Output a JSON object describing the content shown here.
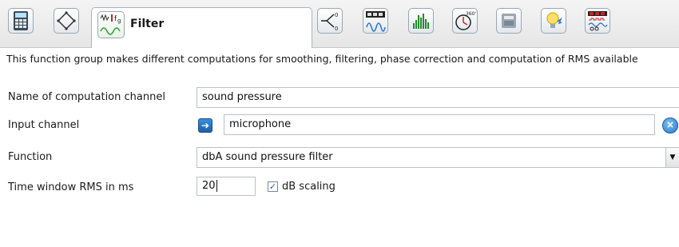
{
  "toolbar": {
    "tabs": [
      {
        "icon": "calculator-icon"
      },
      {
        "icon": "bridge-circuit-icon"
      },
      {
        "icon": "filter-waveform-icon",
        "label": "Filter",
        "active": true
      },
      {
        "icon": "switch-diagram-icon"
      },
      {
        "icon": "counter-waveform-icon"
      },
      {
        "icon": "spectrum-bars-icon"
      },
      {
        "icon": "angle-360-icon"
      },
      {
        "icon": "device-icon"
      },
      {
        "icon": "lightbulb-icon"
      },
      {
        "icon": "signal-display-icon"
      }
    ]
  },
  "description": "This function group makes different computations for smoothing, filtering, phase correction and computation of RMS available",
  "form": {
    "computation_channel_label": "Name of computation channel",
    "computation_channel_value": "sound pressure",
    "input_channel_label": "Input channel",
    "input_channel_value": "microphone",
    "function_label": "Function",
    "function_value": "dbA sound pressure filter",
    "rms_label": "Time window RMS in ms",
    "rms_value": "20",
    "db_scaling_label": "dB scaling",
    "db_scaling_checked": true
  },
  "colors": {
    "accent": "#1f5fa8",
    "border": "#b9c2c9"
  }
}
